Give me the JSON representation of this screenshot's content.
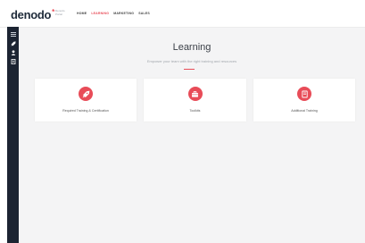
{
  "header": {
    "logo_text": "denodo",
    "logo_mark": "*",
    "portal_line1": "Denodo",
    "portal_line2": "Portal",
    "nav": [
      {
        "label": "HOME"
      },
      {
        "label": "LEARNING"
      },
      {
        "label": "MARKETING"
      },
      {
        "label": "SALES"
      }
    ],
    "active_nav": "LEARNING"
  },
  "sidebar": {
    "icons": [
      "menu-icon",
      "rocket-icon",
      "person-icon",
      "document-icon"
    ]
  },
  "main": {
    "title": "Learning",
    "subtitle": "Empower your team with the right training and resources",
    "cards": [
      {
        "label": "Required Training & Certification",
        "icon": "rocket-icon"
      },
      {
        "label": "Toolkits",
        "icon": "toolbox-icon"
      },
      {
        "label": "Additional Training",
        "icon": "book-icon"
      }
    ]
  },
  "colors": {
    "accent": "#e84c58",
    "sidebar": "#1c2432",
    "background": "#f4f4f5"
  }
}
